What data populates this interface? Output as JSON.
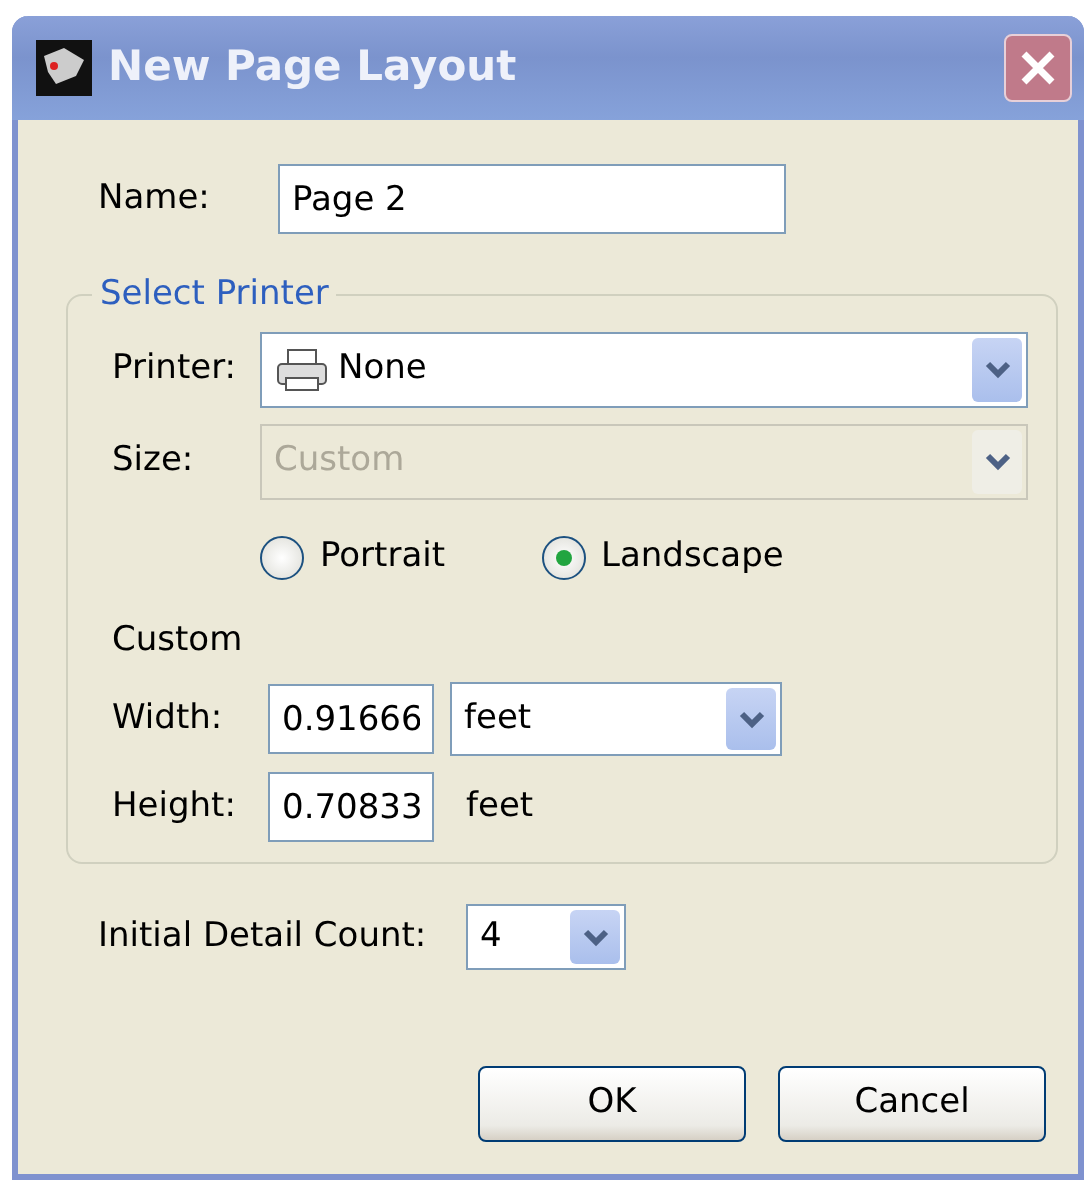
{
  "window": {
    "title": "New Page Layout"
  },
  "name_field": {
    "label": "Name:",
    "value": "Page 2"
  },
  "printer_group": {
    "legend": "Select Printer",
    "printer": {
      "label": "Printer:",
      "value": "None",
      "disabled": false
    },
    "size": {
      "label": "Size:",
      "value": "Custom",
      "disabled": true
    },
    "orientation": [
      {
        "label": "Portrait",
        "selected": false
      },
      {
        "label": "Landscape",
        "selected": true
      }
    ],
    "custom_label": "Custom",
    "width": {
      "label": "Width:",
      "value": "0.91666",
      "unit": "feet"
    },
    "height": {
      "label": "Height:",
      "value": "0.70833",
      "unit": "feet"
    }
  },
  "initial_detail_count": {
    "label": "Initial Detail Count:",
    "value": "4"
  },
  "buttons": [
    "OK",
    "Cancel"
  ]
}
